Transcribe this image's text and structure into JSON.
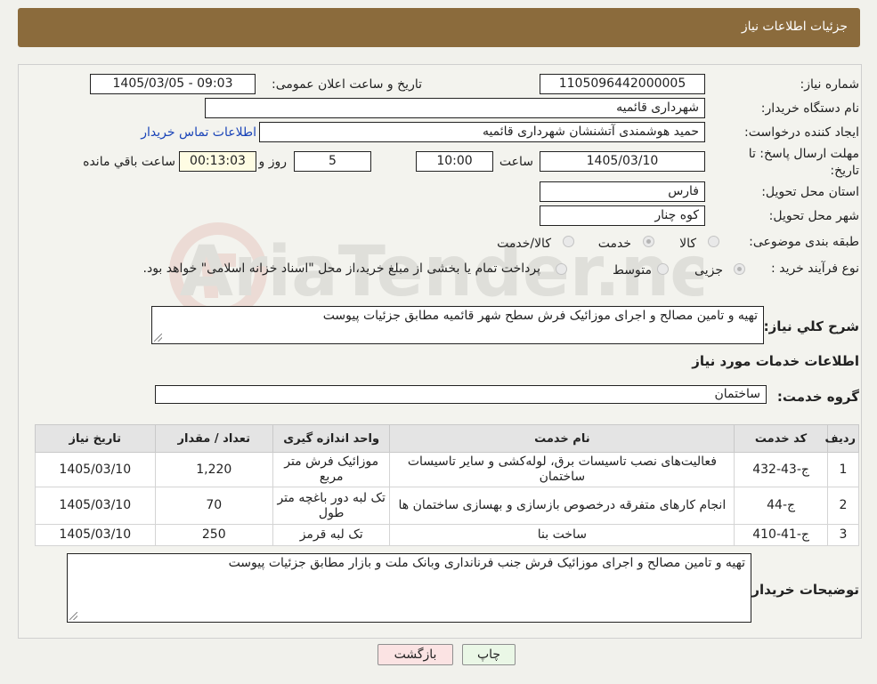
{
  "header": {
    "title": "جزئیات اطلاعات نیاز"
  },
  "fields": {
    "need_number_label": "شماره نیاز:",
    "need_number": "1105096442000005",
    "announce_label": "تاریخ و ساعت اعلان عمومی:",
    "announce_value": "1405/03/05 - 09:03",
    "buyer_org_label": "نام دستگاه خریدار:",
    "buyer_org": "شهرداری قائمیه",
    "creator_label": "ایجاد کننده درخواست:",
    "creator": "حمید هوشمندی آتشنشان شهرداری قائمیه",
    "contact_link": "اطلاعات تماس خریدار",
    "deadline_label": "مهلت ارسال پاسخ: تا تاریخ:",
    "deadline_date": "1405/03/10",
    "time_label": "ساعت",
    "deadline_time": "10:00",
    "days_value": "5",
    "days_label": "روز و",
    "remaining_time": "00:13:03",
    "remaining_label": "ساعت باقي مانده",
    "province_label": "استان محل تحویل:",
    "province": "فارس",
    "city_label": "شهر محل تحویل:",
    "city": "کوه چنار",
    "category_label": "طبقه بندی موضوعی:",
    "category_options": [
      "کالا",
      "خدمت",
      "کالا/خدمت"
    ],
    "process_label": "نوع فرآیند خرید :",
    "process_options": [
      "جزیی",
      "متوسط"
    ],
    "payment_note": "پرداخت تمام یا بخشی از مبلغ خرید،از محل \"اسناد خزانه اسلامی\" خواهد بود.",
    "summary_label": "شرح کلي نیاز:",
    "summary": "تهیه و تامین مصالح و اجرای موزائیک فرش سطح شهر قائمیه مطابق جزئیات پیوست",
    "services_heading": "اطلاعات خدمات مورد نیاز",
    "service_group_label": "گروه خدمت:",
    "service_group": "ساختمان",
    "buyer_notes_label": "توضیحات خریدار:",
    "buyer_notes": "تهیه و تامین مصالح و اجرای موزائیک فرش جنب فرنانداری وبانک ملت و بازار مطابق جزئیات پیوست"
  },
  "table": {
    "headers": [
      "ردیف",
      "کد خدمت",
      "نام خدمت",
      "واحد اندازه گیری",
      "تعداد / مقدار",
      "تاریخ نیاز"
    ],
    "rows": [
      [
        "1",
        "ج-43-432",
        "فعالیت‌های نصب تاسیسات برق، لوله‌کشی و سایر تاسیسات ساختمان",
        "موزائیک فرش متر مربع",
        "1,220",
        "1405/03/10"
      ],
      [
        "2",
        "ج-44",
        "انجام کارهای متفرقه درخصوص بازسازی و بهسازی ساختمان ها",
        "تک لبه دور باغچه متر طول",
        "70",
        "1405/03/10"
      ],
      [
        "3",
        "ج-41-410",
        "ساخت بنا",
        "تک لبه قرمز",
        "250",
        "1405/03/10"
      ]
    ]
  },
  "buttons": {
    "print": "چاپ",
    "back": "بازگشت"
  },
  "watermark": {
    "text": "AriaTender.neT"
  }
}
